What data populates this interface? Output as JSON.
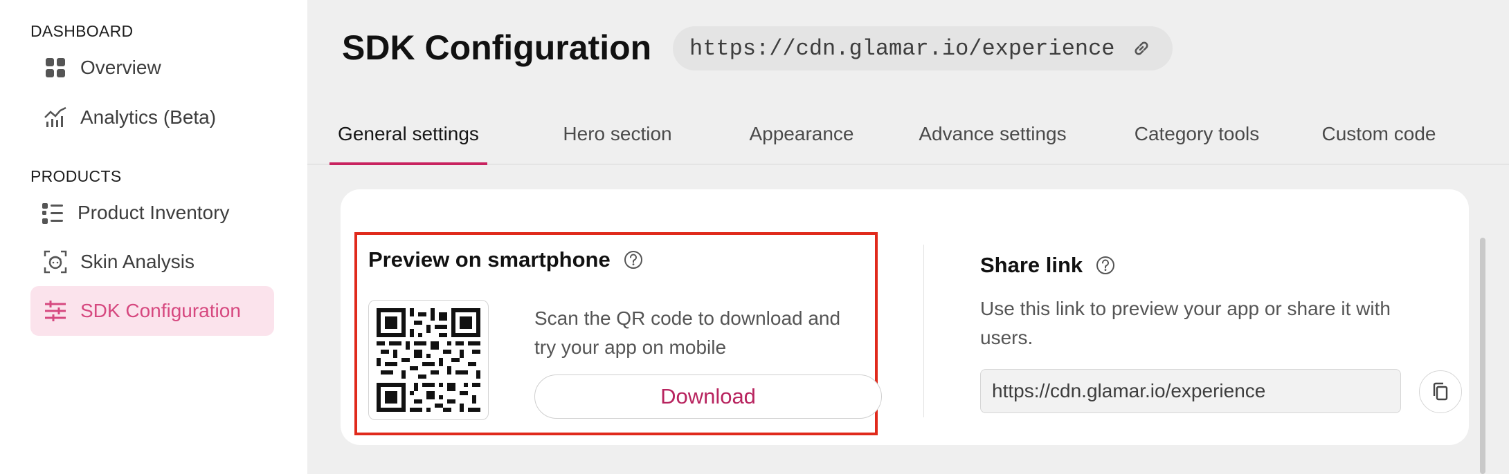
{
  "sidebar": {
    "sections": [
      {
        "heading": "DASHBOARD",
        "items": [
          {
            "label": "Overview",
            "icon": "grid-icon"
          },
          {
            "label": "Analytics (Beta)",
            "icon": "analytics-icon"
          }
        ]
      },
      {
        "heading": "PRODUCTS",
        "items": [
          {
            "label": "Product Inventory",
            "icon": "list-icon"
          },
          {
            "label": "Skin Analysis",
            "icon": "face-scan-icon"
          },
          {
            "label": "SDK Configuration",
            "icon": "sliders-icon",
            "active": true
          }
        ]
      }
    ]
  },
  "header": {
    "title": "SDK Configuration",
    "url": "https://cdn.glamar.io/experience"
  },
  "tabs": [
    {
      "label": "General settings",
      "active": true
    },
    {
      "label": "Hero section"
    },
    {
      "label": "Appearance"
    },
    {
      "label": "Advance settings"
    },
    {
      "label": "Category tools"
    },
    {
      "label": "Custom code"
    }
  ],
  "preview": {
    "title": "Preview on smartphone",
    "description": "Scan the QR code to download and try your app on mobile",
    "download_label": "Download"
  },
  "share": {
    "title": "Share link",
    "description": "Use this link to preview your app or share it with users.",
    "link_value": "https://cdn.glamar.io/experience"
  },
  "colors": {
    "accent": "#c8235f",
    "active_nav_bg": "#fbe3ec",
    "active_nav_text": "#d6487f",
    "highlight_border": "#e02a1c"
  }
}
